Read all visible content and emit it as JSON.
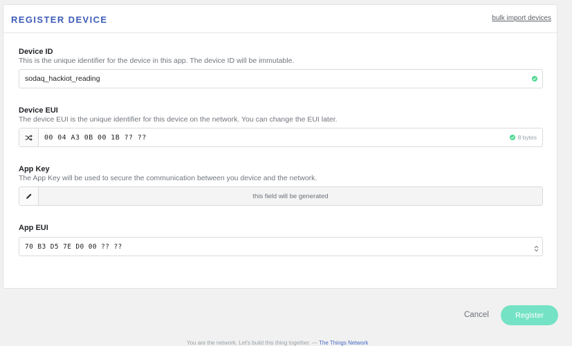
{
  "header": {
    "title": "REGISTER DEVICE",
    "bulk_import_label": "bulk import devices"
  },
  "fields": {
    "device_id": {
      "label": "Device ID",
      "description": "This is the unique identifier for the device in this app. The device ID will be immutable.",
      "value": "sodaq_hackiot_reading"
    },
    "device_eui": {
      "label": "Device EUI",
      "description": "The device EUI is the unique identifier for this device on the network. You can change the EUI later.",
      "value": "00 04 A3 0B 00 1B ?? ??",
      "byte_count": "8 bytes"
    },
    "app_key": {
      "label": "App Key",
      "description": "The App Key will be used to secure the communication between you device and the network.",
      "placeholder": "this field will be generated"
    },
    "app_eui": {
      "label": "App EUI",
      "value": "70 B3 D5 7E D0 00 ?? ??"
    }
  },
  "actions": {
    "cancel_label": "Cancel",
    "register_label": "Register"
  },
  "footer": {
    "text": "You are the network. Let's build this thing together. — ",
    "link": "The Things Network"
  },
  "colors": {
    "accent": "#3c5bb8",
    "register_button": "#74e2c4",
    "valid": "#4cd890"
  },
  "icons": {
    "valid": "check-circle-icon",
    "randomize": "shuffle-icon",
    "edit": "pencil-icon",
    "select": "chevron-up-down-icon"
  }
}
